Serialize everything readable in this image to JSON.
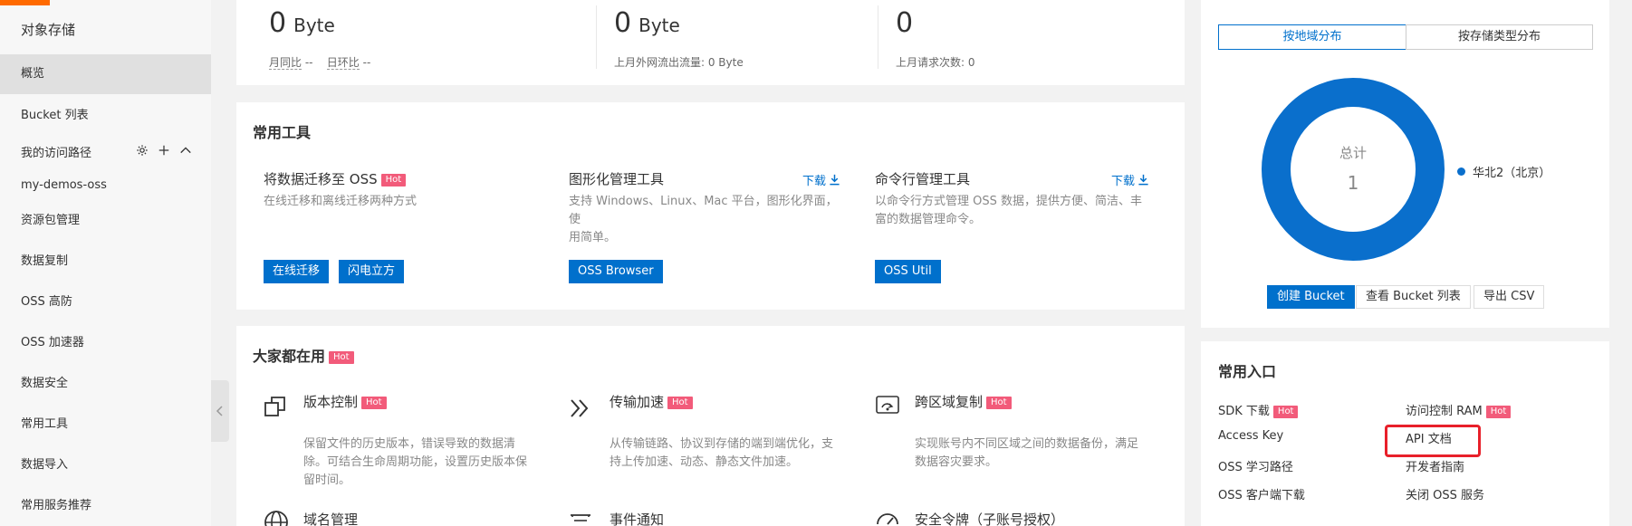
{
  "sidebar": {
    "title": "对象存储",
    "items": [
      {
        "label": "概览",
        "active": true
      },
      {
        "label": "Bucket 列表"
      }
    ],
    "group_label": "我的访问路径",
    "group_items": [
      {
        "label": "my-demos-oss"
      },
      {
        "label": "资源包管理"
      },
      {
        "label": "数据复制"
      },
      {
        "label": "OSS 高防"
      },
      {
        "label": "OSS 加速器"
      },
      {
        "label": "数据安全"
      },
      {
        "label": "常用工具"
      },
      {
        "label": "数据导入"
      },
      {
        "label": "常用服务推荐"
      }
    ]
  },
  "stats": {
    "storage": {
      "value": "0",
      "unit": "Byte",
      "mom_label": "月同比",
      "mom_value": "--",
      "yoy_label": "日环比",
      "yoy_value": "--"
    },
    "traffic": {
      "value": "0",
      "unit": "Byte",
      "sub": "上月外网流出流量: 0 Byte"
    },
    "requests": {
      "value": "0",
      "sub": "上月请求次数:   0"
    }
  },
  "tools": {
    "title": "常用工具",
    "hot_label": "Hot",
    "migration": {
      "name": "将数据迁移至 OSS",
      "desc": "在线迁移和离线迁移两种方式",
      "btn_online": "在线迁移",
      "btn_cube": "闪电立方"
    },
    "gui": {
      "name": "图形化管理工具",
      "download": "下载",
      "desc_line1": "支持 Windows、Linux、Mac 平台，图形化界面，使",
      "desc_line2": "用简单。",
      "btn": "OSS Browser"
    },
    "cli": {
      "name": "命令行管理工具",
      "download": "下载",
      "desc_line1": "以命令行方式管理 OSS 数据，提供方便、简洁、丰",
      "desc_line2": "富的数据管理命令。",
      "btn": "OSS Util"
    }
  },
  "popular": {
    "title": "大家都在用",
    "hot_label": "Hot",
    "features": [
      {
        "name": "版本控制",
        "icon": "copy-icon",
        "desc": [
          "保留文件的历史版本，错误导致的数据清",
          "除。可结合生命周期功能，设置历史版本保",
          "留时间。"
        ]
      },
      {
        "name": "传输加速",
        "icon": "double-chevron-right-icon",
        "desc": [
          "从传输链路、协议到存储的端到端优化，支",
          "持上传加速、动态、静态文件加速。"
        ]
      },
      {
        "name": "跨区域复制",
        "icon": "region-replicate-icon",
        "desc": [
          "实现账号内不同区域之间的数据备份，满足",
          "数据容灾要求。"
        ]
      },
      {
        "name": "域名管理",
        "icon": "globe-icon"
      },
      {
        "name": "事件通知",
        "icon": "notification-icon"
      },
      {
        "name": "安全令牌（子账号授权）",
        "icon": "token-icon"
      }
    ]
  },
  "distribution": {
    "tab_region": "按地域分布",
    "tab_type": "按存储类型分布",
    "total_label": "总计",
    "total_value": "1",
    "legend": "华北2（北京）",
    "ring_color": "#0a6fcc",
    "btn_create": "创建 Bucket",
    "btn_list": "查看 Bucket 列表",
    "btn_export": "导出 CSV"
  },
  "entries": {
    "title": "常用入口",
    "hot_label": "Hot",
    "left": [
      {
        "label": "SDK 下载",
        "hot": true
      },
      {
        "label": "Access Key"
      },
      {
        "label": "OSS 学习路径"
      },
      {
        "label": "OSS 客户端下载"
      }
    ],
    "right": [
      {
        "label": "访问控制 RAM",
        "hot": true
      },
      {
        "label": "API 文档"
      },
      {
        "label": "开发者指南"
      },
      {
        "label": "关闭 OSS 服务"
      }
    ]
  }
}
